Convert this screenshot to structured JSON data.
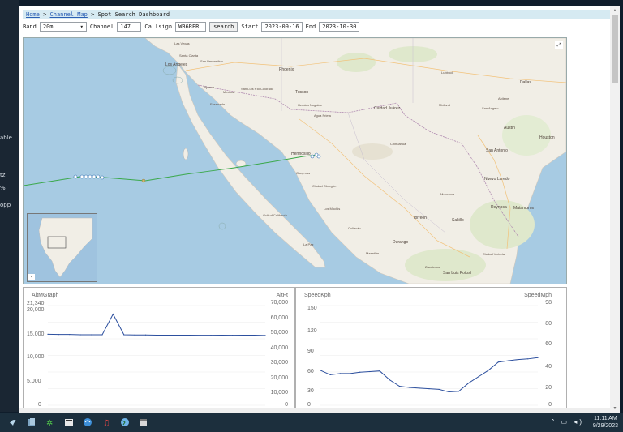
{
  "background_app": {
    "side_labels": [
      "able",
      "tz",
      "%",
      "opp"
    ]
  },
  "breadcrumb": {
    "home": "Home",
    "sep1": ">",
    "channel_map": "Channel Map",
    "sep2": ">",
    "current": "Spot Search Dashboard"
  },
  "controls": {
    "band_label": "Band",
    "band_value": "20m",
    "channel_label": "Channel",
    "channel_value": "147",
    "callsign_label": "Callsign",
    "callsign_value": "WB6RER",
    "search_label": "search",
    "start_label": "Start",
    "start_value": "2023-09-16",
    "end_label": "End",
    "end_value": "2023-10-30"
  },
  "map": {
    "fullscreen_glyph": "⤢",
    "minimap_toggle_glyph": "‹",
    "labels": [
      "Las Vegas",
      "Santa Clarita",
      "Los Angeles",
      "San Bernardino",
      "Phoenix",
      "Tijuana",
      "Mexicali",
      "San Luis Río Colorado",
      "Tucson",
      "Ensenada",
      "Heroica Nogales",
      "Agua Prieta",
      "Ciudad Juárez",
      "Lubbock",
      "Dallas",
      "Abilene",
      "Midland",
      "San Angelo",
      "Austin",
      "Houston",
      "San Antonio",
      "Chihuahua",
      "Hermosillo",
      "Guaymas",
      "Ciudad Obregón",
      "Los Mochis",
      "Culiacán",
      "Nuevo Laredo",
      "Monclova",
      "Saltillo",
      "Torreón",
      "Durango",
      "Mazatlán",
      "Reynosa",
      "Matamoros",
      "Zacatecas",
      "San Luis Potosí",
      "Ciudad Victoria",
      "La Paz",
      "Gulf of California"
    ]
  },
  "chart_alt": {
    "left_title": "AltMGraph",
    "left_max_label": "21,340",
    "left_ticks": [
      "20,000",
      "15,000",
      "10,000",
      "5,000",
      "0"
    ],
    "right_title": "AltFt",
    "right_ticks": [
      "70,000",
      "60,000",
      "50,000",
      "40,000",
      "30,000",
      "20,000",
      "10,000",
      "0"
    ]
  },
  "chart_speed": {
    "left_title": "SpeedKph",
    "left_ticks": [
      "150",
      "120",
      "90",
      "60",
      "30",
      "0"
    ],
    "right_title": "SpeedMph",
    "right_ticks": [
      "98",
      "80",
      "60",
      "40",
      "20",
      "0"
    ]
  },
  "chart_data": [
    {
      "type": "line",
      "title": "",
      "ylabel": "AltMGraph",
      "ylabel_right": "AltFt",
      "ylim": [
        0,
        21340
      ],
      "ylim_right": [
        0,
        70000
      ],
      "x": [
        0,
        1,
        2,
        3,
        4,
        5,
        6,
        7,
        8,
        9,
        10,
        11,
        12,
        13,
        14,
        15,
        16,
        17,
        18,
        19,
        20
      ],
      "series": [
        {
          "values": [
            15200,
            15150,
            15150,
            15100,
            15100,
            15100,
            19500,
            15100,
            15050,
            15050,
            15000,
            15000,
            15000,
            15000,
            14980,
            14980,
            15000,
            14980,
            15000,
            15000,
            14950
          ]
        }
      ]
    },
    {
      "type": "line",
      "title": "",
      "ylabel": "SpeedKph",
      "ylabel_right": "SpeedMph",
      "ylim": [
        0,
        157
      ],
      "ylim_right": [
        0,
        98
      ],
      "x": [
        0,
        1,
        2,
        3,
        4,
        5,
        6,
        7,
        8,
        9,
        10,
        11,
        12,
        13,
        14,
        15,
        16,
        17,
        18,
        19,
        20,
        21,
        22
      ],
      "series": [
        {
          "values": [
            55,
            48,
            50,
            50,
            52,
            53,
            54,
            40,
            30,
            28,
            27,
            26,
            25,
            21,
            22,
            35,
            45,
            55,
            68,
            70,
            72,
            73,
            75
          ]
        }
      ]
    }
  ],
  "taskbar": {
    "time": "11:11 AM",
    "date": "9/29/2023",
    "tray_glyphs": "^ ▭ ◂)"
  },
  "colors": {
    "breadcrumb_bg": "#d6eaf2",
    "track": "#3aa84a",
    "chart_line": "#2c4f9e",
    "water": "#a7cbe3",
    "land": "#f1eee6"
  }
}
